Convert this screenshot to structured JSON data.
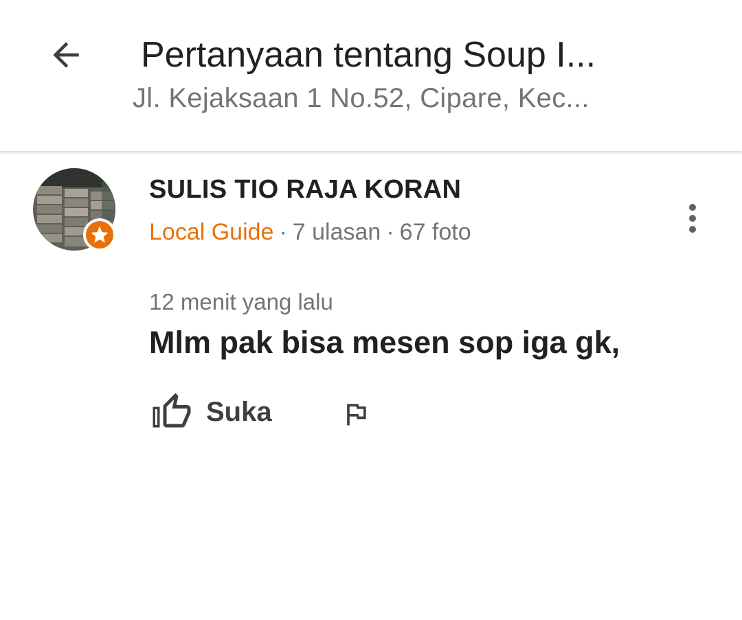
{
  "header": {
    "back_icon": "arrow-left-icon",
    "title": "Pertanyaan tentang Soup I...",
    "subtitle": "Jl. Kejaksaan 1 No.52, Cipare, Kec..."
  },
  "question": {
    "author": {
      "name": "SULIS TIO RAJA KORAN",
      "badge_icon": "star-icon",
      "level": "Local Guide",
      "separator": "·",
      "reviews": "7 ulasan",
      "photos": "67 foto"
    },
    "timestamp": "12 menit yang lalu",
    "text": "Mlm pak bisa mesen sop iga gk,",
    "actions": {
      "like_label": "Suka",
      "like_icon": "thumbs-up-icon",
      "flag_icon": "flag-icon",
      "more_icon": "more-vert-icon"
    }
  },
  "colors": {
    "accent": "#e8710a",
    "text_primary": "#202124",
    "text_secondary": "#70757a"
  }
}
